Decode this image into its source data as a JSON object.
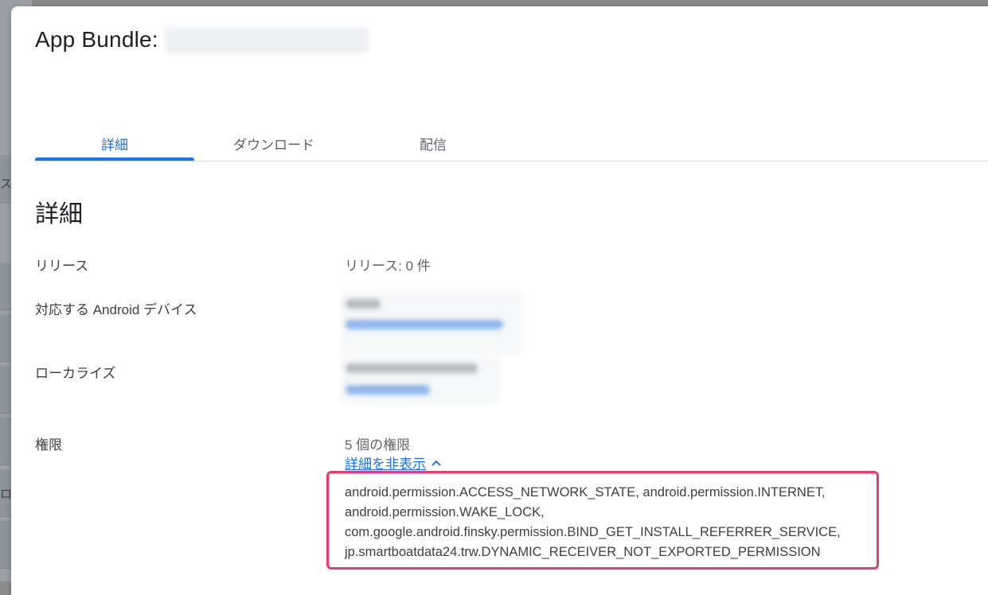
{
  "dialog": {
    "title": "App Bundle:",
    "title_version": "(redacted)"
  },
  "tabs": [
    {
      "label": "詳細",
      "active": true
    },
    {
      "label": "ダウンロード",
      "active": false
    },
    {
      "label": "配信",
      "active": false
    }
  ],
  "section_title": "詳細",
  "rows": {
    "release": {
      "label": "リリース",
      "value": "リリース: 0 件"
    },
    "devices": {
      "label": "対応する Android デバイス"
    },
    "localize": {
      "label": "ローカライズ"
    },
    "permissions": {
      "label": "権限",
      "count": "5 個の権限",
      "toggle_link": "詳細を非表示"
    }
  },
  "permission_lines": [
    "android.permission.ACCESS_NETWORK_STATE, android.permission.INTERNET,",
    "android.permission.WAKE_LOCK,",
    "com.google.android.finsky.permission.BIND_GET_INSTALL_REFERRER_SERVICE,",
    "jp.smartboatdata24.trw.DYNAMIC_RECEIVER_NOT_EXPORTED_PERMISSION"
  ],
  "background_glyphs": [
    "ス",
    "ロ"
  ],
  "colors": {
    "accent": "#1a73e8",
    "highlight_border": "#ea3a6b"
  },
  "icons": {
    "toggle": "chevron-up-icon"
  }
}
